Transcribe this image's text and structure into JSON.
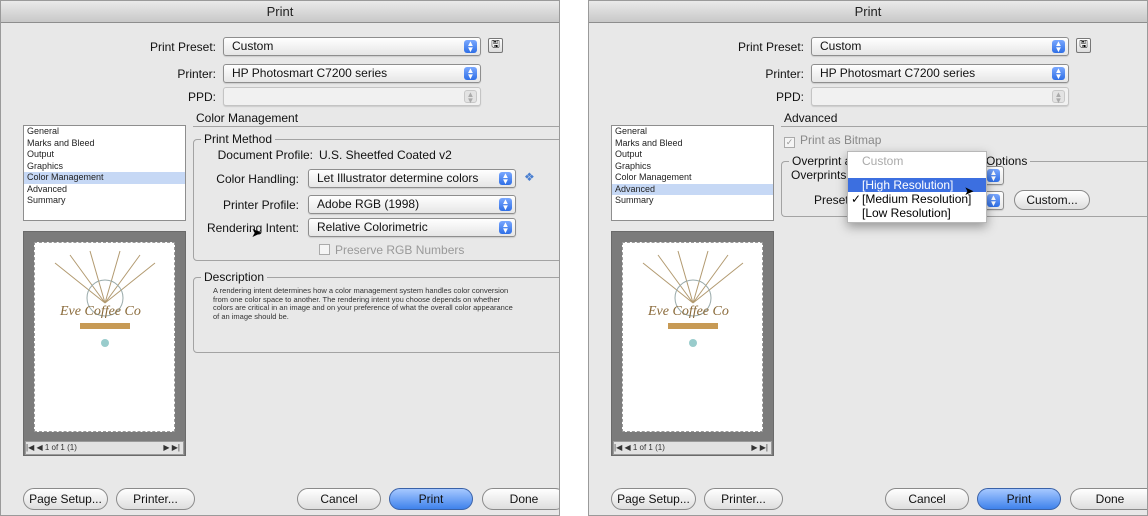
{
  "dialog1": {
    "title": "Print",
    "print_preset_label": "Print Preset:",
    "print_preset_value": "Custom",
    "printer_label": "Printer:",
    "printer_value": "HP Photosmart C7200 series",
    "ppd_label": "PPD:",
    "section_title": "Color Management",
    "sidebar": [
      "General",
      "Marks and Bleed",
      "Output",
      "Graphics",
      "Color Management",
      "Advanced",
      "Summary"
    ],
    "sidebar_selected": "Color Management",
    "print_method_title": "Print Method",
    "doc_profile_label": "Document Profile:",
    "doc_profile_value": "U.S. Sheetfed Coated v2",
    "color_handling_label": "Color Handling:",
    "color_handling_value": "Let Illustrator determine colors",
    "printer_profile_label": "Printer Profile:",
    "printer_profile_value": "Adobe RGB (1998)",
    "rendering_intent_label": "Rendering Intent:",
    "rendering_intent_value": "Relative Colorimetric",
    "preserve_rgb_label": "Preserve RGB Numbers",
    "description_title": "Description",
    "description_text": "A rendering intent determines how a color management system handles color conversion from one color space to another. The rendering intent you choose depends on whether colors are critical in an image and on your preference of what the overall color appearance of an image should be.",
    "page_nav": "1 of 1 (1)",
    "buttons": {
      "page_setup": "Page Setup...",
      "printer": "Printer...",
      "cancel": "Cancel",
      "print": "Print",
      "done": "Done"
    }
  },
  "dialog2": {
    "title": "Print",
    "print_preset_label": "Print Preset:",
    "print_preset_value": "Custom",
    "printer_label": "Printer:",
    "printer_value": "HP Photosmart C7200 series",
    "ppd_label": "PPD:",
    "section_title": "Advanced",
    "sidebar": [
      "General",
      "Marks and Bleed",
      "Output",
      "Graphics",
      "Color Management",
      "Advanced",
      "Summary"
    ],
    "sidebar_selected": "Advanced",
    "print_as_bitmap": "Print as Bitmap",
    "overprint_title_left": "Overprint a",
    "overprint_title_right": "Options",
    "overprints_label": "Overprints:",
    "preset_label": "Preset:",
    "custom_button": "Custom...",
    "menu_items": [
      "Custom",
      "[High Resolution]",
      "[Medium Resolution]",
      "[Low Resolution]"
    ],
    "menu_checked": "[Medium Resolution]",
    "menu_highlighted": "[High Resolution]",
    "page_nav": "1 of 1 (1)",
    "buttons": {
      "page_setup": "Page Setup...",
      "printer": "Printer...",
      "cancel": "Cancel",
      "print": "Print",
      "done": "Done"
    }
  },
  "colors": {
    "selection": "#c6d8f5",
    "default_button": "#3f82ec",
    "menu_highlight": "#3c6fe0"
  }
}
